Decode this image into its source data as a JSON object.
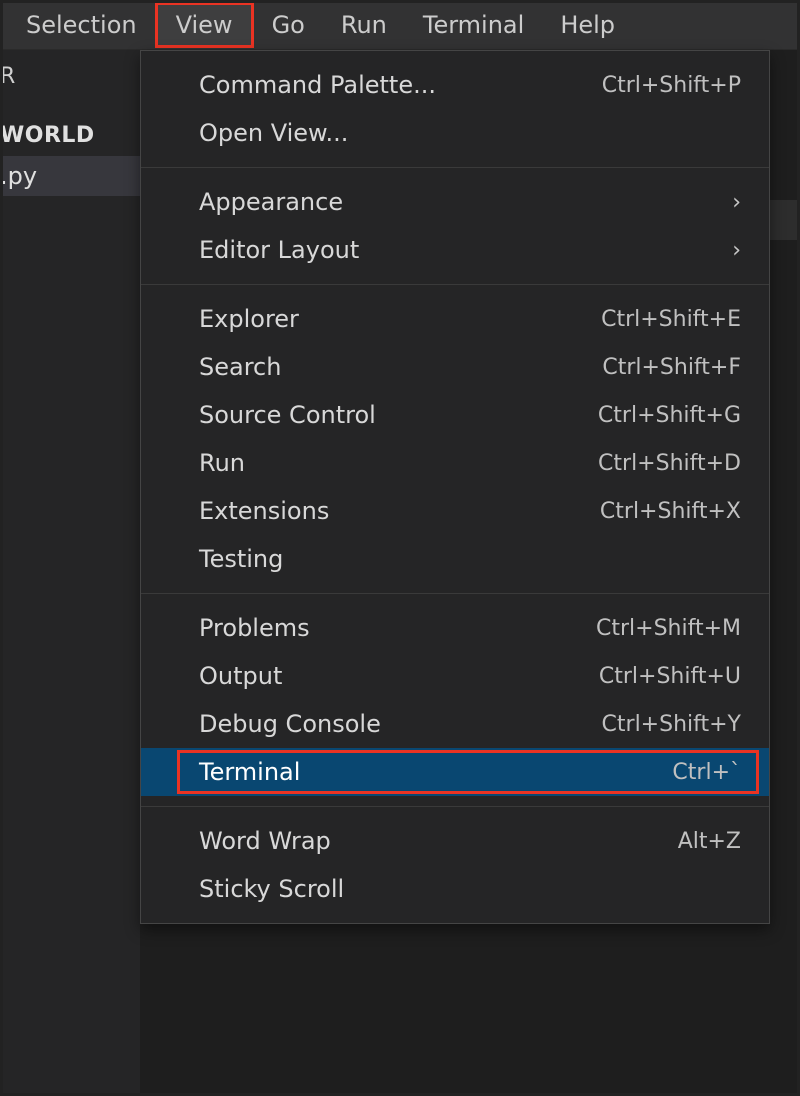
{
  "menubar": {
    "items": [
      "Selection",
      "View",
      "Go",
      "Run",
      "Terminal",
      "Help"
    ],
    "active_index": 1
  },
  "sidebar": {
    "line_r": "R",
    "section": "WORLD",
    "file": ".py"
  },
  "dropdown": {
    "groups": [
      [
        {
          "label": "Command Palette...",
          "shortcut": "Ctrl+Shift+P",
          "submenu": false
        },
        {
          "label": "Open View...",
          "shortcut": "",
          "submenu": false
        }
      ],
      [
        {
          "label": "Appearance",
          "shortcut": "",
          "submenu": true
        },
        {
          "label": "Editor Layout",
          "shortcut": "",
          "submenu": true
        }
      ],
      [
        {
          "label": "Explorer",
          "shortcut": "Ctrl+Shift+E",
          "submenu": false
        },
        {
          "label": "Search",
          "shortcut": "Ctrl+Shift+F",
          "submenu": false
        },
        {
          "label": "Source Control",
          "shortcut": "Ctrl+Shift+G",
          "submenu": false
        },
        {
          "label": "Run",
          "shortcut": "Ctrl+Shift+D",
          "submenu": false
        },
        {
          "label": "Extensions",
          "shortcut": "Ctrl+Shift+X",
          "submenu": false
        },
        {
          "label": "Testing",
          "shortcut": "",
          "submenu": false
        }
      ],
      [
        {
          "label": "Problems",
          "shortcut": "Ctrl+Shift+M",
          "submenu": false
        },
        {
          "label": "Output",
          "shortcut": "Ctrl+Shift+U",
          "submenu": false
        },
        {
          "label": "Debug Console",
          "shortcut": "Ctrl+Shift+Y",
          "submenu": false
        },
        {
          "label": "Terminal",
          "shortcut": "Ctrl+`",
          "submenu": false,
          "highlighted": true,
          "red_box": true
        }
      ],
      [
        {
          "label": "Word Wrap",
          "shortcut": "Alt+Z",
          "submenu": false
        },
        {
          "label": "Sticky Scroll",
          "shortcut": "",
          "submenu": false
        }
      ]
    ]
  }
}
